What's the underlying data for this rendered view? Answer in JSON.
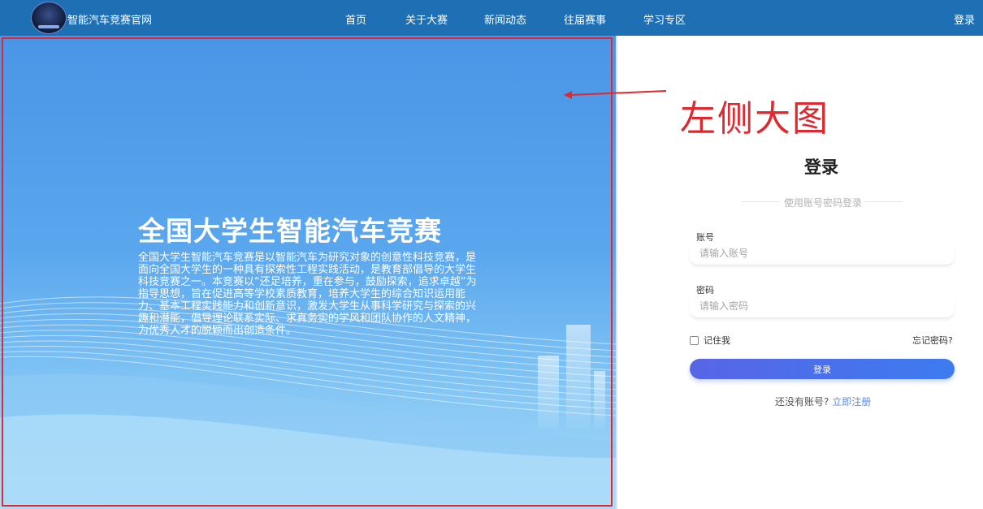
{
  "header": {
    "site_title": "智能汽车竞赛官网",
    "nav": [
      "首页",
      "关于大赛",
      "新闻动态",
      "往届赛事",
      "学习专区"
    ],
    "login_link": "登录"
  },
  "hero": {
    "title": "全国大学生智能汽车竞赛",
    "description": "全国大学生智能汽车竞赛是以智能汽车为研究对象的创意性科技竞赛，是面向全国大学生的一种具有探索性工程实践活动，是教育部倡导的大学生科技竞赛之一。本竞赛以“还足培养，重在参与，鼓励探索，追求卓越”为指导思想，旨在促进高等学校素质教育，培养大学生的综合知识运用能力、基本工程实践能力和创新意识，激发大学生从事科学研究与探索的兴趣和潜能，倡导理论联系实际、求真务实的学风和团队协作的人文精神，为优秀人才的脱颖而出创造条件。"
  },
  "annotation": {
    "label": "左侧大图",
    "color": "#e0282e"
  },
  "login_form": {
    "title": "登录",
    "subtitle": "使用账号密码登录",
    "account_label": "账号",
    "account_placeholder": "请输入账号",
    "password_label": "密码",
    "password_placeholder": "请输入密码",
    "remember_label": "记住我",
    "forgot_label": "忘记密码?",
    "submit_label": "登录",
    "no_account_text": "还没有账号?",
    "register_label": "立即注册"
  },
  "colors": {
    "header_bg": "#1f6fb5",
    "accent": "#3d7bf0",
    "annotation_red": "#e0282e"
  }
}
